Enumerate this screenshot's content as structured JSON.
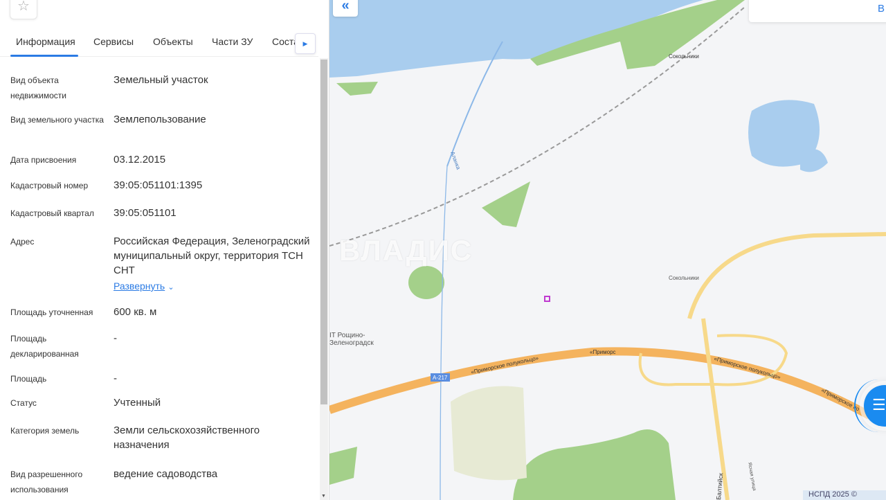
{
  "panel": {
    "tabs": [
      {
        "label": "Информация",
        "active": true
      },
      {
        "label": "Сервисы"
      },
      {
        "label": "Объекты"
      },
      {
        "label": "Части ЗУ"
      },
      {
        "label": "Соста"
      }
    ],
    "rows": [
      {
        "label": "Вид объекта недвижимости",
        "value": "Земельный участок"
      },
      {
        "label": "Вид земельного участка",
        "value": "Землепользование"
      },
      {
        "label": "Дата присвоения",
        "value": "03.12.2015"
      },
      {
        "label": "Кадастровый номер",
        "value": "39:05:051101:1395"
      },
      {
        "label": "Кадастровый квартал",
        "value": "39:05:051101"
      },
      {
        "label": "Адрес",
        "value": "Российская Федерация, Зеленоградский муниципальный округ, территория ТСН СНТ",
        "expand": "Развернуть"
      },
      {
        "label": "Площадь уточненная",
        "value": "600 кв. м"
      },
      {
        "label": "Площадь декларированная",
        "value": "-"
      },
      {
        "label": "Площадь",
        "value": "-"
      },
      {
        "label": "Статус",
        "value": "Учтенный"
      },
      {
        "label": "Категория земель",
        "value": "Земли сельскохозяйственного назначения"
      },
      {
        "label": "Вид разрешенного использования",
        "value": "ведение садоводства"
      }
    ]
  },
  "map": {
    "top_card_text": "В",
    "watermark": "ВЛАДИС",
    "copyright": "НСПД 2025 ©",
    "labels": {
      "sokolniki1": "Сокольники",
      "sokolniki2": "Сокольники",
      "alanka": "Аланка",
      "roshchino1": "IT Рощино-",
      "roshchino2": "Зеленоградск",
      "a217": "А-217",
      "road1": "«Приморское полукольцо»",
      "road2": "«Приморс",
      "road3": "«Приморское полукольцо»",
      "road4": "«Приморское по",
      "baltiysk": "Балтийск",
      "yasnaya": "Ясная улица"
    },
    "colors": {
      "water": "#a9cdee",
      "forest": "#a4d08a",
      "highway": "#f4b35e",
      "accent": "#2b7be4"
    }
  }
}
